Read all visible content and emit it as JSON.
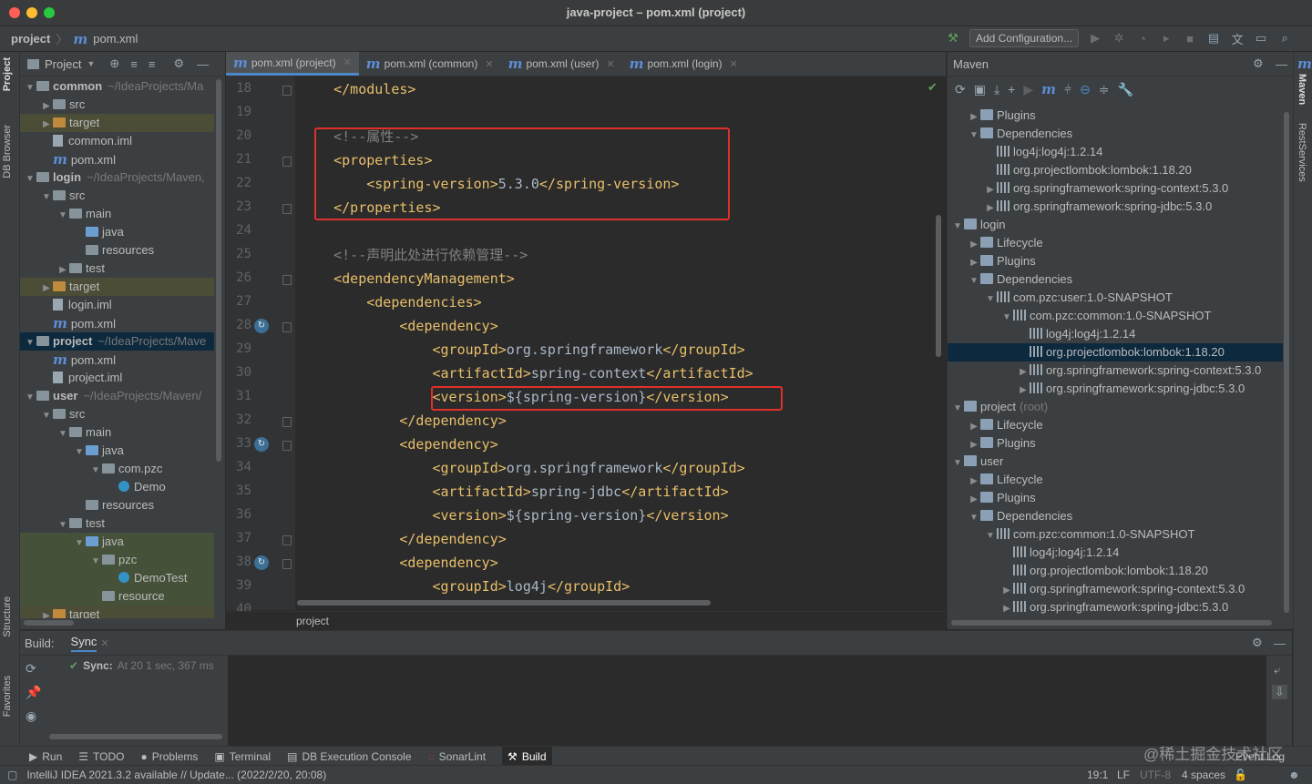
{
  "window": {
    "title": "java-project – pom.xml (project)"
  },
  "navbar": {
    "crumbs": [
      "project",
      "pom.xml"
    ],
    "add_configuration": "Add Configuration..."
  },
  "left_strip": {
    "tabs": [
      "Project",
      "DB Browser",
      "Structure",
      "Favorites"
    ]
  },
  "right_strip": {
    "tabs": [
      "Maven",
      "RestServices"
    ]
  },
  "project_panel": {
    "header": "Project",
    "tree": [
      {
        "label": "common",
        "hint": "~/IdeaProjects/Ma",
        "bold": true
      },
      {
        "label": "src"
      },
      {
        "label": "target"
      },
      {
        "label": "common.iml"
      },
      {
        "label": "pom.xml"
      },
      {
        "label": "login",
        "hint": "~/IdeaProjects/Maven,",
        "bold": true
      },
      {
        "label": "src"
      },
      {
        "label": "main"
      },
      {
        "label": "java"
      },
      {
        "label": "resources"
      },
      {
        "label": "test"
      },
      {
        "label": "target"
      },
      {
        "label": "login.iml"
      },
      {
        "label": "pom.xml"
      },
      {
        "label": "project",
        "hint": "~/IdeaProjects/Mave",
        "bold": true
      },
      {
        "label": "pom.xml"
      },
      {
        "label": "project.iml"
      },
      {
        "label": "user",
        "hint": "~/IdeaProjects/Maven/",
        "bold": true
      },
      {
        "label": "src"
      },
      {
        "label": "main"
      },
      {
        "label": "java"
      },
      {
        "label": "com.pzc"
      },
      {
        "label": "Demo"
      },
      {
        "label": "resources"
      },
      {
        "label": "test"
      },
      {
        "label": "java"
      },
      {
        "label": "pzc"
      },
      {
        "label": "DemoTest"
      },
      {
        "label": "resource"
      },
      {
        "label": "target"
      }
    ]
  },
  "editor": {
    "tabs": [
      "pom.xml (project)",
      "pom.xml (common)",
      "pom.xml (user)",
      "pom.xml (login)"
    ],
    "line_numbers": [
      "18",
      "19",
      "20",
      "21",
      "22",
      "23",
      "24",
      "25",
      "26",
      "27",
      "28",
      "29",
      "30",
      "31",
      "32",
      "33",
      "34",
      "35",
      "36",
      "37",
      "38",
      "39",
      "40"
    ],
    "lines": [
      "    </modules>",
      "",
      "    <!--属性-->",
      "    <properties>",
      "        <spring-version>5.3.0</spring-version>",
      "    </properties>",
      "",
      "    <!--声明此处进行依赖管理-->",
      "    <dependencyManagement>",
      "        <dependencies>",
      "            <dependency>",
      "                <groupId>org.springframework</groupId>",
      "                <artifactId>spring-context</artifactId>",
      "                <version>${spring-version}</version>",
      "            </dependency>",
      "            <dependency>",
      "                <groupId>org.springframework</groupId>",
      "                <artifactId>spring-jdbc</artifactId>",
      "                <version>${spring-version}</version>",
      "            </dependency>",
      "            <dependency>",
      "                <groupId>log4j</groupId>",
      ""
    ],
    "breadcrumb": "project"
  },
  "maven": {
    "title": "Maven",
    "tree": [
      {
        "label": "Plugins"
      },
      {
        "label": "Dependencies"
      },
      {
        "label": "log4j:log4j:1.2.14"
      },
      {
        "label": "org.projectlombok:lombok:1.18.20"
      },
      {
        "label": "org.springframework:spring-context:5.3.0"
      },
      {
        "label": "org.springframework:spring-jdbc:5.3.0"
      },
      {
        "label": "login"
      },
      {
        "label": "Lifecycle"
      },
      {
        "label": "Plugins"
      },
      {
        "label": "Dependencies"
      },
      {
        "label": "com.pzc:user:1.0-SNAPSHOT"
      },
      {
        "label": "com.pzc:common:1.0-SNAPSHOT"
      },
      {
        "label": "log4j:log4j:1.2.14"
      },
      {
        "label": "org.projectlombok:lombok:1.18.20"
      },
      {
        "label": "org.springframework:spring-context:5.3.0"
      },
      {
        "label": "org.springframework:spring-jdbc:5.3.0"
      },
      {
        "label": "project",
        "hint": "(root)"
      },
      {
        "label": "Lifecycle"
      },
      {
        "label": "Plugins"
      },
      {
        "label": "user"
      },
      {
        "label": "Lifecycle"
      },
      {
        "label": "Plugins"
      },
      {
        "label": "Dependencies"
      },
      {
        "label": "com.pzc:common:1.0-SNAPSHOT"
      },
      {
        "label": "log4j:log4j:1.2.14"
      },
      {
        "label": "org.projectlombok:lombok:1.18.20"
      },
      {
        "label": "org.springframework:spring-context:5.3.0"
      },
      {
        "label": "org.springframework:spring-jdbc:5.3.0"
      }
    ]
  },
  "build": {
    "label": "Build:",
    "tab": "Sync",
    "sync_title": "Sync:",
    "sync_status": "At 20 1 sec, 367 ms"
  },
  "bottom_tools": [
    "Run",
    "TODO",
    "Problems",
    "Terminal",
    "DB Execution Console",
    "SonarLint",
    "Build"
  ],
  "event_log": "Event Log",
  "watermark": "@稀土掘金技术社区",
  "status": {
    "message": "IntelliJ IDEA 2021.3.2 available // Update... (2022/2/20, 20:08)",
    "position": "19:1",
    "line_sep": "LF",
    "encoding": "UTF-8",
    "indent": "4 spaces"
  },
  "colors": {
    "accent": "#4a88c7",
    "highlight_box": "#e0302c",
    "tag": "#e8bf6a",
    "comment": "#808080"
  }
}
